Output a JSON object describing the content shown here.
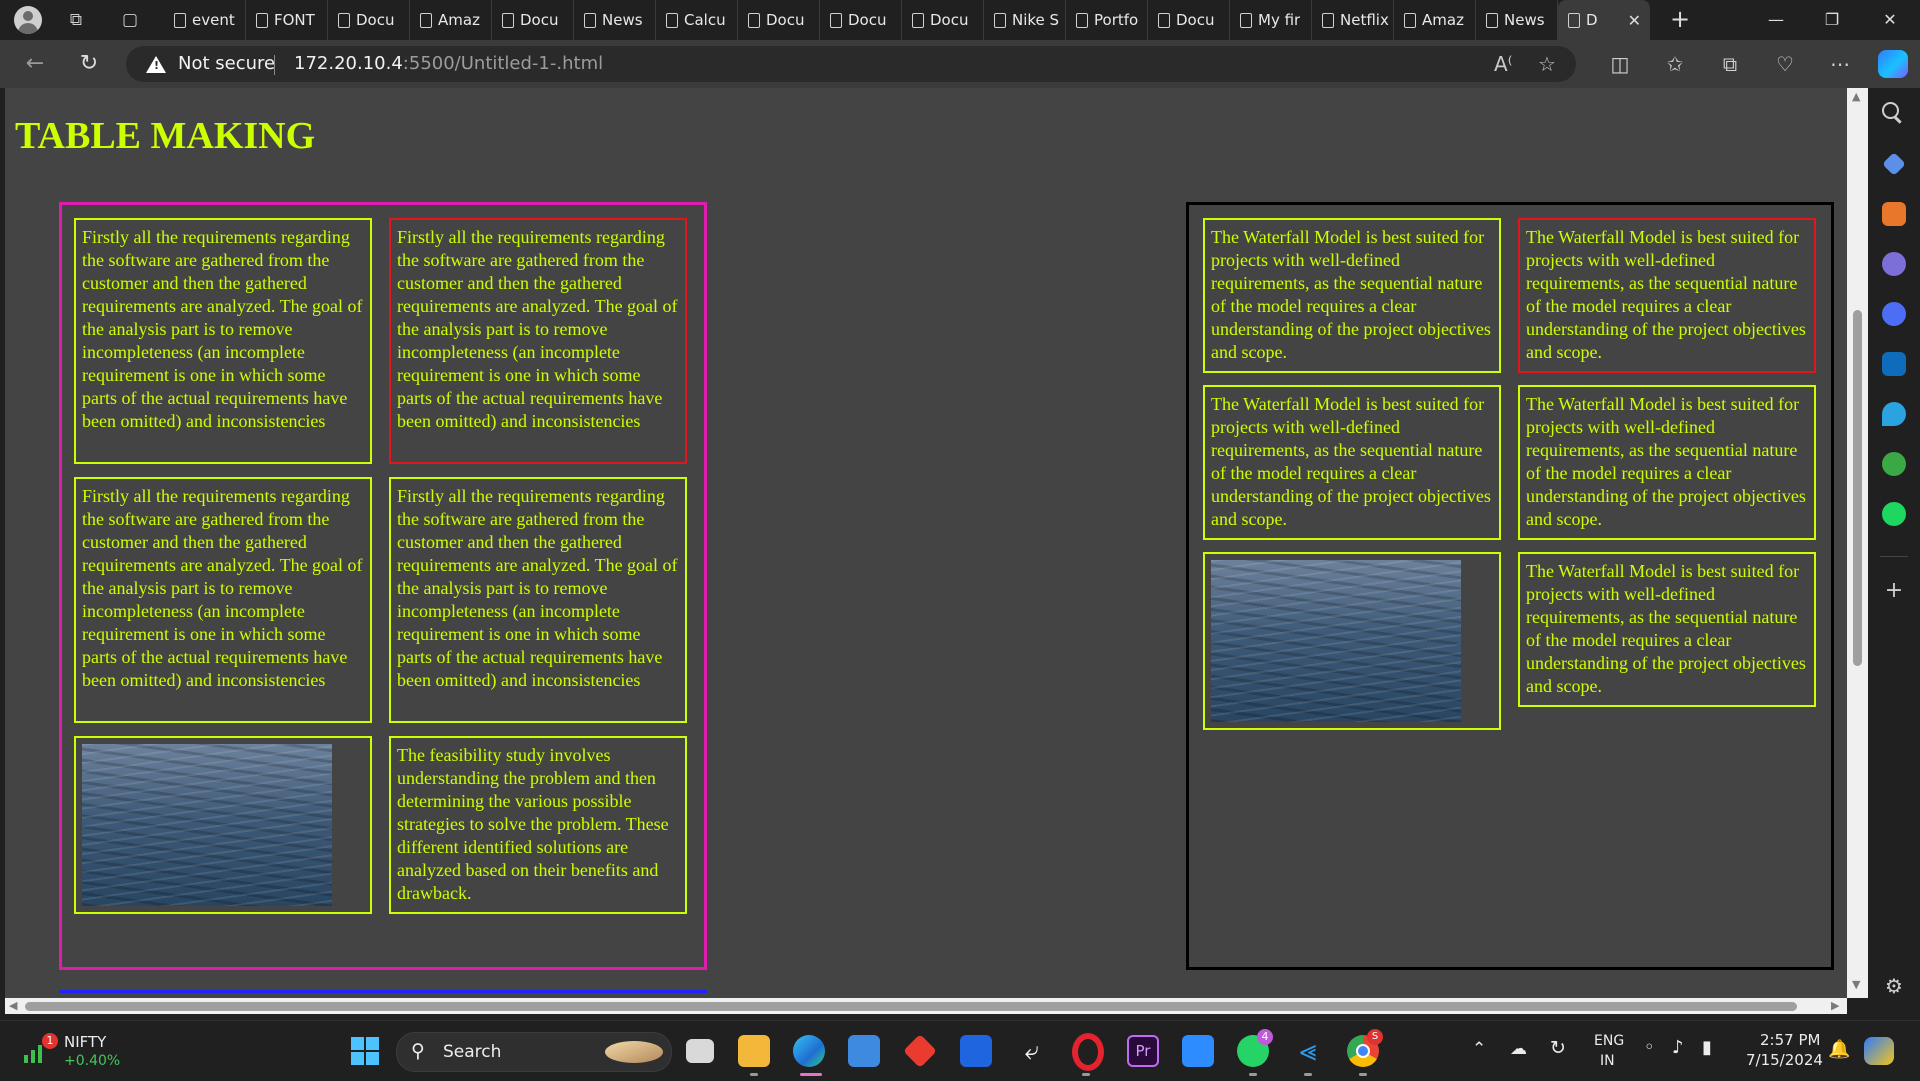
{
  "browser": {
    "tabs": [
      {
        "label": "event",
        "active": false
      },
      {
        "label": "FONT",
        "active": false
      },
      {
        "label": "Docu",
        "active": false
      },
      {
        "label": "Amaz",
        "active": false
      },
      {
        "label": "Docu",
        "active": false
      },
      {
        "label": "News",
        "active": false
      },
      {
        "label": "Calcu",
        "active": false
      },
      {
        "label": "Docu",
        "active": false
      },
      {
        "label": "Docu",
        "active": false
      },
      {
        "label": "Docu",
        "active": false
      },
      {
        "label": "Nike S",
        "active": false
      },
      {
        "label": "Portfo",
        "active": false
      },
      {
        "label": "Docu",
        "active": false
      },
      {
        "label": "My fir",
        "active": false
      },
      {
        "label": "Netflix",
        "active": false
      },
      {
        "label": "Amaz",
        "active": false
      },
      {
        "label": "News",
        "active": false
      },
      {
        "label": "D",
        "active": true
      }
    ],
    "security_label": "Not secure",
    "url_host": "172.20.10.4",
    "url_path": ":5500/Untitled-1-.html"
  },
  "page": {
    "title": "TABLE MAKING",
    "left_table": {
      "border_color": "#e11ab0",
      "req_text": "Firstly all the requirements regarding the software are gathered from the customer and then the gathered requirements are analyzed. The goal of the analysis part is to remove incompleteness (an incomplete requirement is one in which some parts of the actual requirements have been omitted) and inconsistencies",
      "feasibility_text": "The feasibility study involves understanding the problem and then determining the various possible strategies to solve the problem. These different identified solutions are analyzed based on their benefits and drawback."
    },
    "right_table": {
      "border_color": "#000000",
      "waterfall_text": "The Waterfall Model is best suited for projects with well-defined requirements, as the sequential nature of the model requires a clear understanding of the project objectives and scope."
    },
    "colors": {
      "text": "#ccff00",
      "cell_border": "#ccff00",
      "highlight_border": "#e0161e",
      "background": "#444444",
      "third_table_border": "#2222ff"
    }
  },
  "taskbar": {
    "stock_name": "NIFTY",
    "stock_change": "+0.40%",
    "stock_badge": "1",
    "search_label": "Search",
    "whatsapp_badge": "4",
    "chrome_badge": "S",
    "lang_top": "ENG",
    "lang_bottom": "IN",
    "time": "2:57 PM",
    "date": "7/15/2024"
  }
}
